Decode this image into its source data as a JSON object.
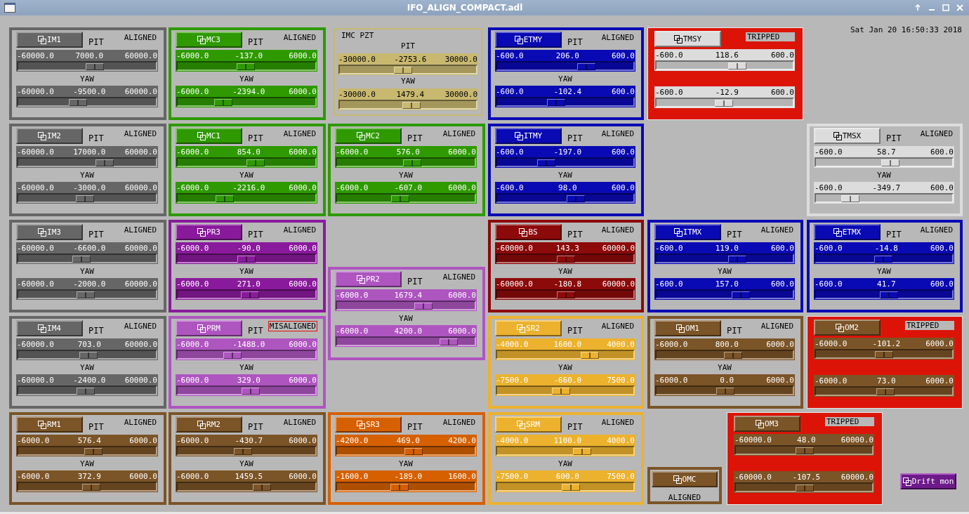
{
  "window": {
    "title": "IFO_ALIGN_COMPACT.adl"
  },
  "timestamp": "Sat Jan 20 16:50:33 2018",
  "panels": [
    {
      "kind": "standard",
      "button": "IM1",
      "pit_label": "PIT",
      "status": "ALIGNED",
      "misaligned": false,
      "tripped": false,
      "color": "#666666",
      "yaw_label": "YAW",
      "sliders": [
        {
          "min": "-60000.0",
          "value": "7000.0",
          "max": "60000.0",
          "level": 0.558
        },
        {
          "min": "-60000.0",
          "value": "-9500.0",
          "max": "60000.0",
          "level": 0.421
        }
      ]
    },
    {
      "kind": "standard",
      "button": "MC3",
      "pit_label": "PIT",
      "status": "ALIGNED",
      "misaligned": false,
      "tripped": false,
      "color": "#2e9a00",
      "yaw_label": "YAW",
      "sliders": [
        {
          "min": "-6000.0",
          "value": "-137.0",
          "max": "6000.0",
          "level": 0.489
        },
        {
          "min": "-6000.0",
          "value": "-2394.0",
          "max": "6000.0",
          "level": 0.3
        }
      ]
    },
    {
      "kind": "pzt",
      "title": "IMC PZT",
      "pit_label": "PIT",
      "color": "#c8b870",
      "yaw_label": "YAW",
      "sliders": [
        {
          "min": "-30000.0",
          "value": "-2753.6",
          "max": "30000.0",
          "level": 0.454
        },
        {
          "min": "-30000.0",
          "value": "1479.4",
          "max": "30000.0",
          "level": 0.525
        }
      ]
    },
    {
      "kind": "standard",
      "button": "ETMY",
      "pit_label": "PIT",
      "status": "ALIGNED",
      "misaligned": false,
      "tripped": false,
      "color": "#0a0ab4",
      "yaw_label": "YAW",
      "sliders": [
        {
          "min": "-600.0",
          "value": "206.0",
          "max": "600.0",
          "level": 0.672
        },
        {
          "min": "-600.0",
          "value": "-102.4",
          "max": "600.0",
          "level": 0.415
        }
      ]
    },
    {
      "kind": "standard",
      "button": "TMSY",
      "status": "TRIPPED",
      "misaligned": false,
      "tripped": true,
      "color": "#dcdcdc",
      "sliders": [
        {
          "min": "-600.0",
          "value": "118.6",
          "max": "600.0",
          "level": 0.599
        },
        {
          "min": "-600.0",
          "value": "-12.9",
          "max": "600.0",
          "level": 0.489
        }
      ]
    },
    {
      "kind": "standard",
      "button": "IM2",
      "pit_label": "PIT",
      "status": "ALIGNED",
      "misaligned": false,
      "tripped": false,
      "color": "#666666",
      "yaw_label": "YAW",
      "sliders": [
        {
          "min": "-60000.0",
          "value": "17000.0",
          "max": "60000.0",
          "level": 0.642
        },
        {
          "min": "-60000.0",
          "value": "-3000.0",
          "max": "60000.0",
          "level": 0.475
        }
      ]
    },
    {
      "kind": "standard",
      "button": "MC1",
      "pit_label": "PIT",
      "status": "ALIGNED",
      "misaligned": false,
      "tripped": false,
      "color": "#2e9a00",
      "yaw_label": "YAW",
      "sliders": [
        {
          "min": "-6000.0",
          "value": "854.0",
          "max": "6000.0",
          "level": 0.571
        },
        {
          "min": "-6000.0",
          "value": "-2216.0",
          "max": "6000.0",
          "level": 0.315
        }
      ]
    },
    {
      "kind": "standard",
      "button": "MC2",
      "pit_label": "PIT",
      "status": "ALIGNED",
      "misaligned": false,
      "tripped": false,
      "color": "#2e9a00",
      "yaw_label": "YAW",
      "sliders": [
        {
          "min": "-6000.0",
          "value": "576.0",
          "max": "6000.0",
          "level": 0.548
        },
        {
          "min": "-6000.0",
          "value": "-607.0",
          "max": "6000.0",
          "level": 0.449
        }
      ]
    },
    {
      "kind": "standard",
      "button": "ITMY",
      "pit_label": "PIT",
      "status": "ALIGNED",
      "misaligned": false,
      "tripped": false,
      "color": "#0a0ab4",
      "yaw_label": "YAW",
      "sliders": [
        {
          "min": "-600.0",
          "value": "-197.0",
          "max": "600.0",
          "level": 0.336
        },
        {
          "min": "-600.0",
          "value": "98.0",
          "max": "600.0",
          "level": 0.582
        }
      ]
    },
    {
      "kind": "standard",
      "button": "TMSX",
      "pit_label": "PIT",
      "status": "ALIGNED",
      "misaligned": false,
      "tripped": false,
      "color": "#dcdcdc",
      "yaw_label": "YAW",
      "sliders": [
        {
          "min": "-600.0",
          "value": "58.7",
          "max": "600.0",
          "level": 0.549
        },
        {
          "min": "-600.0",
          "value": "-349.7",
          "max": "600.0",
          "level": 0.209
        }
      ]
    },
    {
      "kind": "standard",
      "button": "IM3",
      "pit_label": "PIT",
      "status": "ALIGNED",
      "misaligned": false,
      "tripped": false,
      "color": "#666666",
      "yaw_label": "YAW",
      "sliders": [
        {
          "min": "-60000.0",
          "value": "-6600.0",
          "max": "60000.0",
          "level": 0.445
        },
        {
          "min": "-60000.0",
          "value": "-2000.0",
          "max": "60000.0",
          "level": 0.483
        }
      ]
    },
    {
      "kind": "standard",
      "button": "PR3",
      "pit_label": "PIT",
      "status": "ALIGNED",
      "misaligned": false,
      "tripped": false,
      "color": "#8a1a9c",
      "yaw_label": "YAW",
      "sliders": [
        {
          "min": "-6000.0",
          "value": "-90.0",
          "max": "6000.0",
          "level": 0.493
        },
        {
          "min": "-6000.0",
          "value": "271.0",
          "max": "6000.0",
          "level": 0.523
        }
      ]
    },
    {
      "kind": "standard",
      "button": "BS",
      "pit_label": "PIT",
      "status": "ALIGNED",
      "misaligned": false,
      "tripped": false,
      "color": "#8c0a0a",
      "yaw_label": "YAW",
      "sliders": [
        {
          "min": "-60000.0",
          "value": "143.3",
          "max": "60000.0",
          "level": 0.501
        },
        {
          "min": "-60000.0",
          "value": "-180.8",
          "max": "60000.0",
          "level": 0.499
        }
      ]
    },
    {
      "kind": "standard",
      "button": "ITMX",
      "pit_label": "PIT",
      "status": "ALIGNED",
      "misaligned": false,
      "tripped": false,
      "color": "#0a0ab4",
      "yaw_label": "YAW",
      "sliders": [
        {
          "min": "-600.0",
          "value": "119.0",
          "max": "600.0",
          "level": 0.599
        },
        {
          "min": "-600.0",
          "value": "157.0",
          "max": "600.0",
          "level": 0.631
        }
      ]
    },
    {
      "kind": "standard",
      "button": "ETMX",
      "pit_label": "PIT",
      "status": "ALIGNED",
      "misaligned": false,
      "tripped": false,
      "color": "#0a0ab4",
      "yaw_label": "YAW",
      "sliders": [
        {
          "min": "-600.0",
          "value": "-14.8",
          "max": "600.0",
          "level": 0.488
        },
        {
          "min": "-600.0",
          "value": "41.7",
          "max": "600.0",
          "level": 0.535
        }
      ]
    },
    {
      "kind": "standard",
      "button": "PR2",
      "pit_label": "PIT",
      "status": "ALIGNED",
      "misaligned": false,
      "tripped": false,
      "color": "#ae55c0",
      "yaw_label": "YAW",
      "sliders": [
        {
          "min": "-6000.0",
          "value": "1679.4",
          "max": "6000.0",
          "level": 0.64
        },
        {
          "min": "-6000.0",
          "value": "4200.0",
          "max": "6000.0",
          "level": 0.85
        }
      ]
    },
    {
      "kind": "standard",
      "button": "IM4",
      "pit_label": "PIT",
      "status": "ALIGNED",
      "misaligned": false,
      "tripped": false,
      "color": "#666666",
      "yaw_label": "YAW",
      "sliders": [
        {
          "min": "-60000.0",
          "value": "703.0",
          "max": "60000.0",
          "level": 0.506
        },
        {
          "min": "-60000.0",
          "value": "-2400.0",
          "max": "60000.0",
          "level": 0.48
        }
      ]
    },
    {
      "kind": "standard",
      "button": "PRM",
      "pit_label": "PIT",
      "status": "MISALIGNED",
      "misaligned": true,
      "tripped": false,
      "color": "#ae55c0",
      "yaw_label": "YAW",
      "sliders": [
        {
          "min": "-6000.0",
          "value": "-1488.0",
          "max": "6000.0",
          "level": 0.376
        },
        {
          "min": "-6000.0",
          "value": "329.0",
          "max": "6000.0",
          "level": 0.527
        }
      ]
    },
    {
      "kind": "standard",
      "button": "SR2",
      "pit_label": "PIT",
      "status": "ALIGNED",
      "misaligned": false,
      "tripped": false,
      "color": "#ecb22e",
      "yaw_label": "YAW",
      "sliders": [
        {
          "min": "-4000.0",
          "value": "1600.0",
          "max": "4000.0",
          "level": 0.7
        },
        {
          "min": "-7500.0",
          "value": "-660.0",
          "max": "7500.0",
          "level": 0.456
        }
      ]
    },
    {
      "kind": "standard",
      "button": "OM1",
      "pit_label": "PIT",
      "status": "ALIGNED",
      "misaligned": false,
      "tripped": false,
      "color": "#7b5427",
      "yaw_label": "YAW",
      "sliders": [
        {
          "min": "-6000.0",
          "value": "800.0",
          "max": "6000.0",
          "level": 0.567
        },
        {
          "min": "-6000.0",
          "value": "0.0",
          "max": "6000.0",
          "level": 0.5
        }
      ]
    },
    {
      "kind": "standard",
      "button": "OM2",
      "status": "TRIPPED",
      "misaligned": false,
      "tripped": true,
      "color": "#7b5427",
      "sliders": [
        {
          "min": "-6000.0",
          "value": "-101.2",
          "max": "6000.0",
          "level": 0.492
        },
        {
          "min": "-6000.0",
          "value": "73.0",
          "max": "6000.0",
          "level": 0.506
        }
      ]
    },
    {
      "kind": "standard",
      "button": "RM1",
      "pit_label": "PIT",
      "status": "ALIGNED",
      "misaligned": false,
      "tripped": false,
      "color": "#7b5427",
      "yaw_label": "YAW",
      "sliders": [
        {
          "min": "-6000.0",
          "value": "576.4",
          "max": "6000.0",
          "level": 0.548
        },
        {
          "min": "-6000.0",
          "value": "372.9",
          "max": "6000.0",
          "level": 0.531
        }
      ]
    },
    {
      "kind": "standard",
      "button": "RM2",
      "pit_label": "PIT",
      "status": "ALIGNED",
      "misaligned": false,
      "tripped": false,
      "color": "#7b5427",
      "yaw_label": "YAW",
      "sliders": [
        {
          "min": "-6000.0",
          "value": "-430.7",
          "max": "6000.0",
          "level": 0.464
        },
        {
          "min": "-6000.0",
          "value": "1459.5",
          "max": "6000.0",
          "level": 0.622
        }
      ]
    },
    {
      "kind": "standard",
      "button": "SR3",
      "pit_label": "PIT",
      "status": "ALIGNED",
      "misaligned": false,
      "tripped": false,
      "color": "#d66000",
      "yaw_label": "YAW",
      "sliders": [
        {
          "min": "-4200.0",
          "value": "469.0",
          "max": "4200.0",
          "level": 0.556
        },
        {
          "min": "-1600.0",
          "value": "-189.0",
          "max": "1600.0",
          "level": 0.441
        }
      ]
    },
    {
      "kind": "standard",
      "button": "SRM",
      "pit_label": "PIT",
      "status": "ALIGNED",
      "misaligned": false,
      "tripped": false,
      "color": "#ecb22e",
      "yaw_label": "YAW",
      "sliders": [
        {
          "min": "-4000.0",
          "value": "1100.0",
          "max": "4000.0",
          "level": 0.638
        },
        {
          "min": "-7500.0",
          "value": "600.0",
          "max": "7500.0",
          "level": 0.54
        }
      ]
    },
    {
      "kind": "small",
      "button": "OMC",
      "status": "ALIGNED",
      "color": "#7b5427"
    },
    {
      "kind": "standard",
      "button": "OM3",
      "status": "TRIPPED",
      "misaligned": false,
      "tripped": true,
      "color": "#7b5427",
      "sliders": [
        {
          "min": "-60000.0",
          "value": "48.0",
          "max": "60000.0",
          "level": 0.5
        },
        {
          "min": "-60000.0",
          "value": "-107.5",
          "max": "60000.0",
          "level": 0.499
        }
      ]
    }
  ],
  "drift_button": {
    "label": "Drift mon",
    "color": "#6e1a8a"
  }
}
